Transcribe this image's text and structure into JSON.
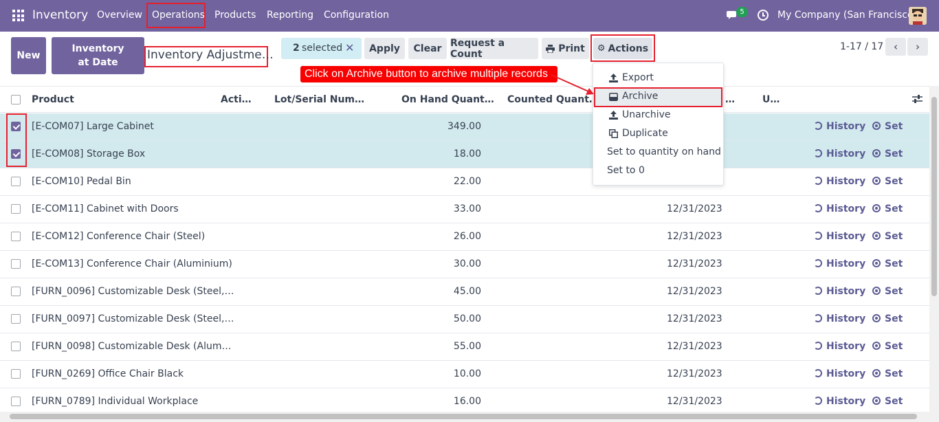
{
  "navbar": {
    "brand": "Inventory",
    "menu": [
      {
        "label": "Overview"
      },
      {
        "label": "Operations"
      },
      {
        "label": "Products"
      },
      {
        "label": "Reporting"
      },
      {
        "label": "Configuration"
      }
    ],
    "messages_count": "5",
    "company": "My Company (San Francisco)",
    "accent_color": "#71639e"
  },
  "control_panel": {
    "new_label": "New",
    "inventory_at_date_label": "Inventory at Date",
    "breadcrumb": "Inventory Adjustme…",
    "selected_count": "2",
    "selected_text": "selected",
    "apply_label": "Apply",
    "clear_label": "Clear",
    "request_count_label": "Request a Count",
    "print_label": "Print",
    "actions_label": "Actions",
    "pager_text": "1-17 / 17"
  },
  "actions_menu": {
    "items": [
      {
        "label": "Export",
        "icon": "upload-icon"
      },
      {
        "label": "Archive",
        "icon": "inbox-icon"
      },
      {
        "label": "Unarchive",
        "icon": "upload-icon"
      },
      {
        "label": "Duplicate",
        "icon": "copy-icon"
      },
      {
        "label": "Set to quantity on hand",
        "icon": ""
      },
      {
        "label": "Set to 0",
        "icon": ""
      }
    ]
  },
  "annotation": {
    "text": "Click on Archive button to archive multiple records"
  },
  "table": {
    "columns": [
      "Product",
      "Acti…",
      "Lot/Serial Num…",
      "On Hand Quant…",
      "Counted Quant…",
      "…",
      "U…"
    ],
    "history_label": "History",
    "set_label": "Set",
    "rows": [
      {
        "product": "[E-COM07] Large Cabinet",
        "on_hand": "349.00",
        "date": "",
        "checked": true
      },
      {
        "product": "[E-COM08] Storage Box",
        "on_hand": "18.00",
        "date": "",
        "checked": true
      },
      {
        "product": "[E-COM10] Pedal Bin",
        "on_hand": "22.00",
        "date": "",
        "checked": false
      },
      {
        "product": "[E-COM11] Cabinet with Doors",
        "on_hand": "33.00",
        "date": "12/31/2023",
        "checked": false
      },
      {
        "product": "[E-COM12] Conference Chair (Steel)",
        "on_hand": "26.00",
        "date": "12/31/2023",
        "checked": false
      },
      {
        "product": "[E-COM13] Conference Chair (Aluminium)",
        "on_hand": "30.00",
        "date": "12/31/2023",
        "checked": false
      },
      {
        "product": "[FURN_0096] Customizable Desk (Steel,…",
        "on_hand": "45.00",
        "date": "12/31/2023",
        "checked": false
      },
      {
        "product": "[FURN_0097] Customizable Desk (Steel,…",
        "on_hand": "50.00",
        "date": "12/31/2023",
        "checked": false
      },
      {
        "product": "[FURN_0098] Customizable Desk (Alum…",
        "on_hand": "55.00",
        "date": "12/31/2023",
        "checked": false
      },
      {
        "product": "[FURN_0269] Office Chair Black",
        "on_hand": "10.00",
        "date": "12/31/2023",
        "checked": false
      },
      {
        "product": "[FURN_0789] Individual Workplace",
        "on_hand": "16.00",
        "date": "12/31/2023",
        "checked": false
      }
    ]
  }
}
